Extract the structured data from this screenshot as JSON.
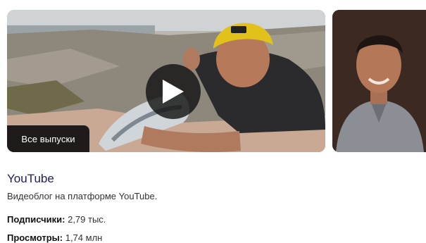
{
  "media": {
    "episodes_button_label": "Все выпуски"
  },
  "channel": {
    "title": "YouTube",
    "description": "Видеоблог на платформе YouTube."
  },
  "stats": [
    {
      "label": "Подписчики:",
      "value": "2,79 тыс."
    },
    {
      "label": "Просмотры:",
      "value": "1,74 млн"
    }
  ],
  "icons": {
    "play": "play-icon"
  },
  "colors": {
    "title": "#1a1d5c",
    "button_bg": "#0f0f0f"
  }
}
